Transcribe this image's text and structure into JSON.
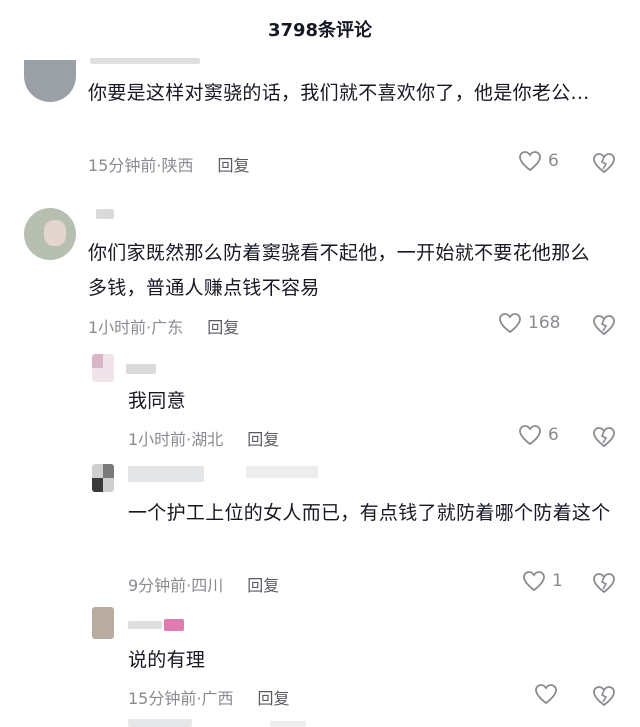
{
  "header": {
    "title": "3798条评论"
  },
  "comments": [
    {
      "text": "你要是这样对窦骁的话，我们就不喜欢你了，他是你老公...",
      "time": "15分钟前·陕西",
      "reply": "回复",
      "likes": "6"
    },
    {
      "text": "你们家既然那么防着窦骁看不起他，一开始就不要花他那么多钱，普通人赚点钱不容易",
      "time": "1小时前·广东",
      "reply": "回复",
      "likes": "168"
    },
    {
      "text": "我同意",
      "time": "1小时前·湖北",
      "reply": "回复",
      "likes": "6"
    },
    {
      "text": "一个护工上位的女人而已，有点钱了就防着哪个防着这个",
      "time": "9分钟前·四川",
      "reply": "回复",
      "likes": "1"
    },
    {
      "text": "说的有理",
      "time": "15分钟前·广西",
      "reply": "回复",
      "likes": ""
    }
  ]
}
